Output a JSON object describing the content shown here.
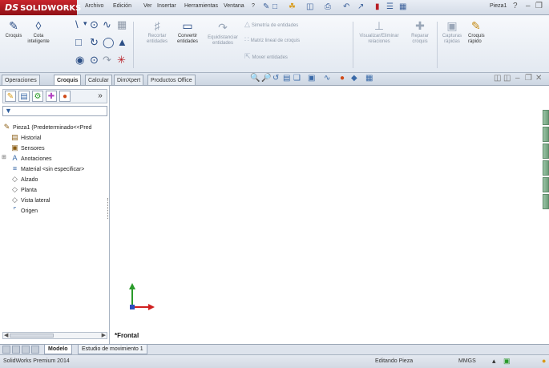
{
  "app": {
    "brand": "SOLIDWORKS",
    "brand_prefix": "DS",
    "document_title": "Pieza1"
  },
  "menu": [
    "Archivo",
    "Edición",
    "Ver",
    "Insertar",
    "Herramientas",
    "Ventana",
    "?"
  ],
  "ribbon": {
    "croquis": "Croquis",
    "cota_inteligente_1": "Cota",
    "cota_inteligente_2": "inteligente",
    "recortar_1": "Recortar",
    "recortar_2": "entidades",
    "convertir_1": "Convertir",
    "convertir_2": "entidades",
    "equidistanciar_1": "Equidistanciar",
    "equidistanciar_2": "entidades",
    "simetria": "Simetría de entidades",
    "matriz": "Matriz lineal de croquis",
    "mover": "Mover entidades",
    "visualizar_1": "Visualizar/Eliminar",
    "visualizar_2": "relaciones",
    "reparar_1": "Reparar",
    "reparar_2": "croquis",
    "capturas_1": "Capturas",
    "capturas_2": "rápidas",
    "croquis_rapido_1": "Croquis",
    "croquis_rapido_2": "rápido"
  },
  "tabs": [
    "Operaciones",
    "Croquis",
    "Calcular",
    "DimXpert",
    "Productos Office"
  ],
  "active_tab": "Croquis",
  "tree": {
    "root": "Pieza1  (Predeterminado<<Pred",
    "items": [
      "Historial",
      "Sensores",
      "Anotaciones",
      "Material <sin especificar>",
      "Alzado",
      "Planta",
      "Vista lateral",
      "Origen"
    ]
  },
  "graphics": {
    "view_label": "*Frontal"
  },
  "model_tabs": [
    "Modelo",
    "Estudio de movimiento 1"
  ],
  "status": {
    "left": "SolidWorks Premium 2014",
    "mode": "Editando Pieza",
    "units": "MMGS"
  },
  "colors": {
    "brand_red": "#b81e25",
    "axis_red": "#d02020",
    "axis_green": "#2a9a2a",
    "axis_blue": "#2c4fc0"
  },
  "icons": [
    "search-icon",
    "gear-icon",
    "filter-icon",
    "expand-icon",
    "origin-icon"
  ]
}
